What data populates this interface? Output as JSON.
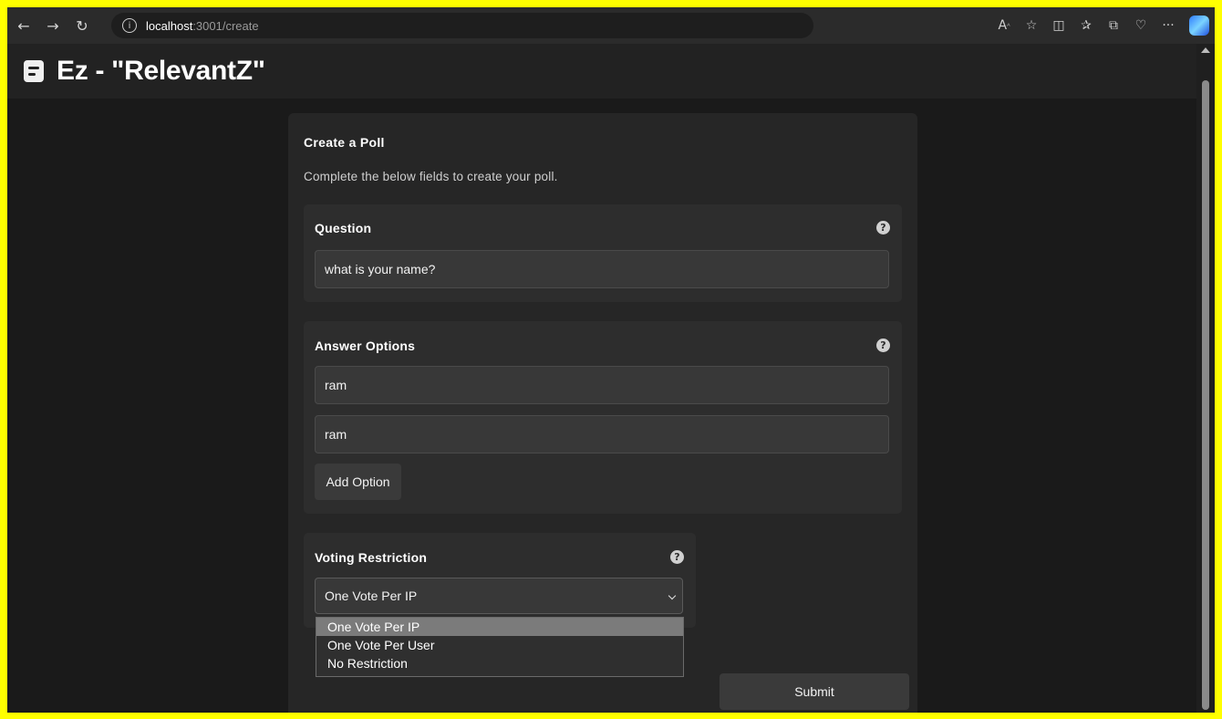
{
  "browser": {
    "url_host": "localhost",
    "url_path": ":3001/create",
    "info_glyph": "i"
  },
  "app": {
    "title": "Ez - \"RelevantZ\""
  },
  "form": {
    "title": "Create a Poll",
    "description": "Complete the below fields to create your poll.",
    "question": {
      "label": "Question",
      "value": "what is your name?"
    },
    "answers": {
      "label": "Answer Options",
      "options": [
        "ram",
        "ram"
      ],
      "add_label": "Add Option"
    },
    "restriction": {
      "label": "Voting Restriction",
      "selected": "One Vote Per IP",
      "options": [
        "One Vote Per IP",
        "One Vote Per User",
        "No Restriction"
      ]
    },
    "submit_label": "Submit",
    "help_glyph": "?"
  }
}
